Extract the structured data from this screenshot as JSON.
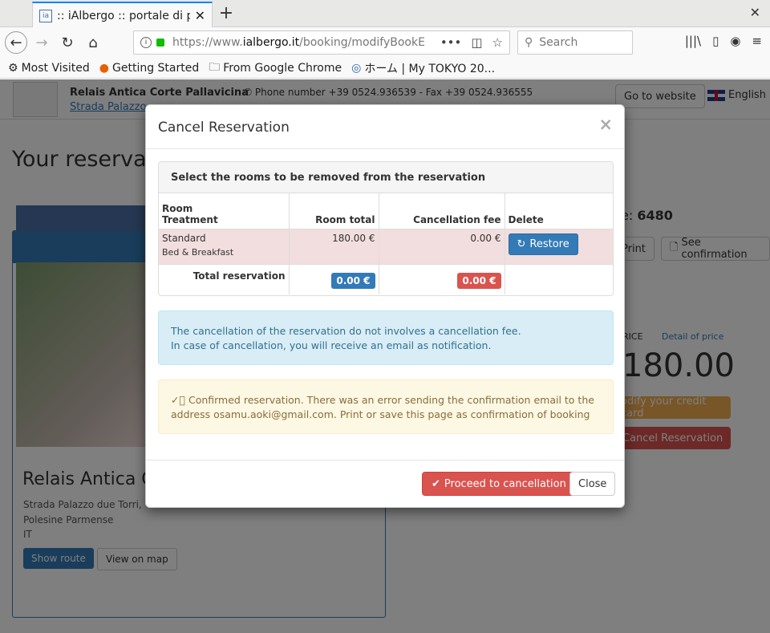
{
  "browser": {
    "tab_title": ":: iAlbergo :: portale di pre",
    "url_prefix": "https://www.",
    "url_domain": "ialbergo.it",
    "url_path": "/booking/modifyBookE",
    "search_placeholder": "Search",
    "bookmarks": [
      {
        "label": "Most Visited",
        "icon": "gear-icon"
      },
      {
        "label": "Getting Started",
        "icon": "firefox-icon"
      },
      {
        "label": "From Google Chrome",
        "icon": "folder-icon"
      },
      {
        "label": "ホーム | My TOKYO 20...",
        "icon": "globe-icon"
      }
    ]
  },
  "page": {
    "hotel_name": "Relais Antica Corte Pallavicina",
    "hotel_address": "Strada Palazzo",
    "contacts": "Phone number +39 0524.936539 - Fax +39 0524.936555",
    "go_website": "Go to website",
    "language": "English",
    "heading": "Your reservati",
    "reservation_code_label": "e:",
    "reservation_code": "6480",
    "print": "Print",
    "see_confirmation": "See confirmation",
    "price_label": "RICE",
    "detail_price": "Detail of price",
    "price": "180.00",
    "modify_card": "odify your credit card",
    "cancel_reservation": "Cancel Reservation",
    "left_name": "Relais Antica C",
    "left_lines": [
      "Strada Palazzo due Torri,",
      "Polesine Parmense",
      "IT"
    ],
    "show_route": "Show route",
    "view_on_map": "View on map"
  },
  "modal": {
    "title": "Cancel Reservation",
    "close_x": "×",
    "panel_title": "Select the rooms to be removed from the reservation",
    "headers": {
      "room": "Room",
      "treatment": "Treatment",
      "room_total": "Room total",
      "cancellation_fee": "Cancellation fee",
      "delete": "Delete"
    },
    "rows": [
      {
        "room": "Standard",
        "treatment": "Bed & Breakfast",
        "room_total": "180.00 €",
        "fee": "0.00 €",
        "action": "Restore"
      }
    ],
    "total_label": "Total reservation",
    "total_room": "0.00 €",
    "total_fee": "0.00 €",
    "info_line1": "The cancellation of the reservation do not involves a cancellation fee.",
    "info_line2": "In case of cancellation, you will receive an email as notification.",
    "warning": "Confirmed reservation. There was an error sending the confirmation email to the address osamu.aoki@gmail.com. Print or save this page as confirmation of booking",
    "proceed": "Proceed to cancellation",
    "close": "Close"
  },
  "colors": {
    "primary": "#337ab7",
    "danger": "#d9534f",
    "warning": "#f0ad4e",
    "info_bg": "#d9edf7",
    "warn_bg": "#fcf8e3",
    "row_deleted": "#f2dede"
  }
}
